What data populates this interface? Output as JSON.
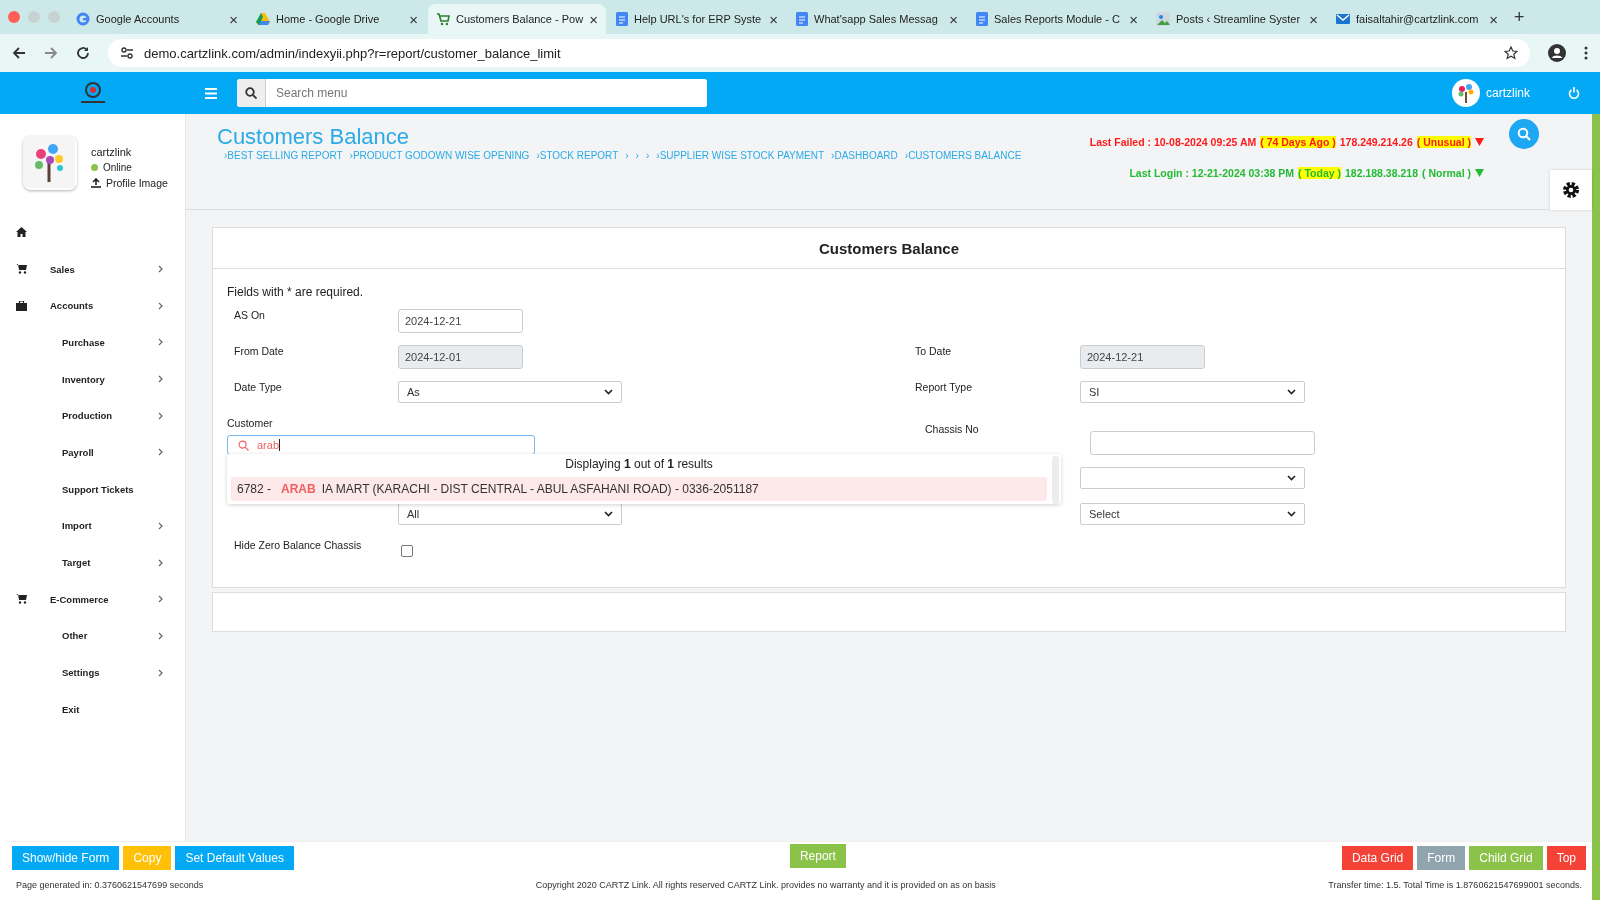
{
  "browser": {
    "tabs": [
      {
        "title": "Google Accounts",
        "kind": "g",
        "selected": false
      },
      {
        "title": "Home - Google Drive",
        "kind": "drive",
        "selected": false
      },
      {
        "title": "Customers Balance - Pow",
        "kind": "cart",
        "selected": true
      },
      {
        "title": "Help URL's for ERP Syste",
        "kind": "doc",
        "selected": false
      },
      {
        "title": "What'sapp Sales Messag",
        "kind": "doc",
        "selected": false
      },
      {
        "title": "Sales Reports Module - C",
        "kind": "doc",
        "selected": false
      },
      {
        "title": "Posts ‹ Streamline Syster",
        "kind": "img",
        "selected": false
      },
      {
        "title": "faisaltahir@cartzlink.com",
        "kind": "mail",
        "selected": false
      }
    ],
    "tab_close": "×",
    "new_tab": "+",
    "url": "demo.cartzlink.com/admin/indexyii.php?r=report/customer_balance_limit"
  },
  "header": {
    "search_placeholder": "Search menu",
    "user": "cartzlink"
  },
  "profile": {
    "name": "cartzlink",
    "status": "Online",
    "upload": "Profile Image"
  },
  "sidebar": [
    {
      "kind": "home",
      "expandable": false
    },
    {
      "label": "Sales",
      "kind": "cart",
      "expandable": true
    },
    {
      "label": "Accounts",
      "kind": "briefcase",
      "expandable": true
    },
    {
      "label": "Purchase",
      "kind": "plain",
      "expandable": true
    },
    {
      "label": "Inventory",
      "kind": "plain",
      "expandable": true
    },
    {
      "label": "Production",
      "kind": "plain",
      "expandable": true
    },
    {
      "label": "Payroll",
      "kind": "plain",
      "expandable": true
    },
    {
      "label": "Support Tickets",
      "kind": "plain",
      "expandable": false
    },
    {
      "label": "Import",
      "kind": "plain",
      "expandable": true
    },
    {
      "label": "Target",
      "kind": "plain",
      "expandable": true
    },
    {
      "label": "E-Commerce",
      "kind": "cart",
      "expandable": true
    },
    {
      "label": "Other",
      "kind": "plain",
      "expandable": true
    },
    {
      "label": "Settings",
      "kind": "plain",
      "expandable": true
    },
    {
      "label": "Exit",
      "kind": "plain",
      "expandable": false
    }
  ],
  "page": {
    "title": "Customers Balance",
    "breadcrumbs": [
      "›BEST SELLING REPORT",
      "›PRODUCT GODOWN WISE OPENING",
      "›STOCK REPORT",
      "›",
      "›",
      "›",
      "›SUPPLIER WISE STOCK PAYMENT",
      "›DASHBOARD",
      "›CUSTOMERS BALANCE"
    ]
  },
  "logins": [
    {
      "color": "#ff1a1a",
      "segments": [
        {
          "text": "Last Failed : 10-08-2024 09:25 AM",
          "highlight": false
        },
        {
          "text": "( 74 Days Ago )",
          "highlight": true
        },
        {
          "text": "178.249.214.26",
          "highlight": false
        },
        {
          "text": "( Unusual )",
          "highlight": true
        }
      ]
    },
    {
      "color": "#22bb33",
      "segments": [
        {
          "text": "Last Login : 12-21-2024 03:38 PM",
          "highlight": false
        },
        {
          "text": "( Today )",
          "highlight": true
        },
        {
          "text": "182.188.38.218",
          "highlight": false
        },
        {
          "text": "( Normal )",
          "highlight": false
        }
      ]
    }
  ],
  "form": {
    "title": "Customers Balance",
    "note": "Fields with * are required.",
    "as_on": {
      "label": "AS On",
      "value": "2024-12-21"
    },
    "from_date": {
      "label": "From Date",
      "value": "2024-12-01",
      "disabled": true
    },
    "to_date": {
      "label": "To Date",
      "value": "2024-12-21",
      "disabled": true
    },
    "date_type": {
      "label": "Date Type",
      "value": "As"
    },
    "report_type": {
      "label": "Report Type",
      "value": "SI"
    },
    "customer": {
      "label": "Customer",
      "value": "arab"
    },
    "chassis": {
      "label": "Chassis No"
    },
    "hidden_select_2": {
      "value": "All"
    },
    "hidden_select_3": {
      "value": "Select"
    },
    "hide_zero": {
      "label": "Hide Zero Balance Chassis",
      "checked": false
    },
    "results": {
      "summary": "Displaying **1** out of **1** results",
      "options": [
        {
          "code": "6782 -",
          "match": "ARAB",
          "rest": "IA MART (KARACHI - DIST CENTRAL - ABUL ASFAHANI ROAD) - 0336-2051187",
          "selected": true
        }
      ]
    }
  },
  "toolbar": {
    "left": [
      {
        "label": "Show/hide Form",
        "color": "#03a9f4"
      },
      {
        "label": "Copy",
        "color": "#ffc107"
      },
      {
        "label": "Set Default Values",
        "color": "#03a9f4"
      }
    ],
    "center": [
      {
        "label": "Report",
        "color": "#8bc34a"
      }
    ],
    "right": [
      {
        "label": "Data Grid",
        "color": "#f44336"
      },
      {
        "label": "Form",
        "color": "#90a4ae"
      },
      {
        "label": "Child Grid",
        "color": "#8bc34a"
      },
      {
        "label": "Top",
        "color": "#f44336"
      }
    ]
  },
  "footer": {
    "left": "Page generated in: 0.3760621547699 seconds",
    "center": "Copyright 2020 CARTZ Link. All rights reserved CARTZ Link. provides no warranty and it is provided on as on basis",
    "right": "Transfer time: 1.5. Total Time is 1.8760621547699001 seconds."
  }
}
